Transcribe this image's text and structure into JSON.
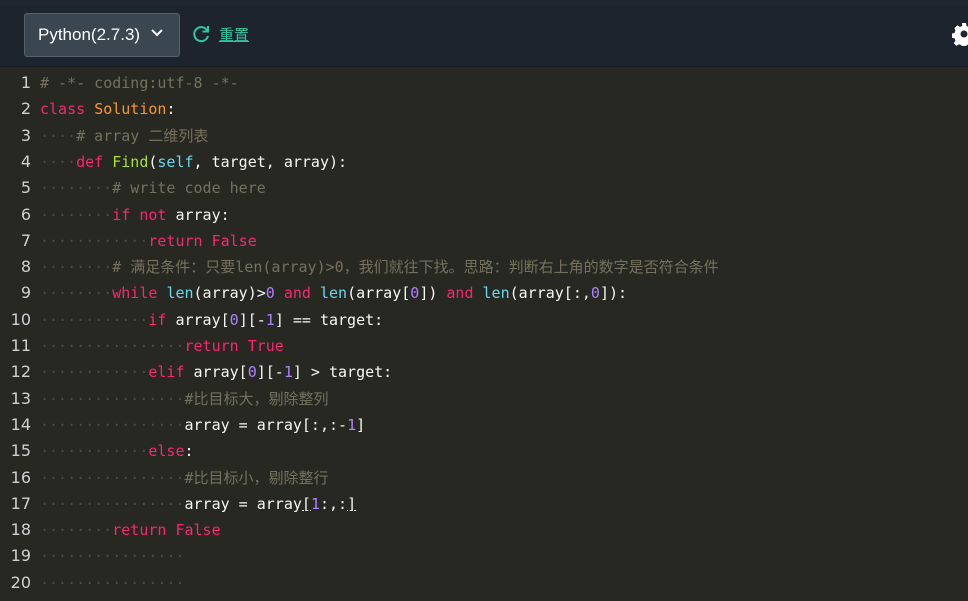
{
  "toolbar": {
    "language": "Python(2.7.3)",
    "reset_label": "重置"
  },
  "editor": {
    "lines": [
      {
        "n": "1",
        "tokens": [
          {
            "t": "# -*- coding:utf-8 -*-",
            "c": "cm"
          }
        ]
      },
      {
        "n": "2",
        "tokens": [
          {
            "t": "class",
            "c": "kw"
          },
          {
            "t": " ",
            "c": ""
          },
          {
            "t": "Solution",
            "c": "cls"
          },
          {
            "t": ":",
            "c": ""
          }
        ]
      },
      {
        "n": "3",
        "tokens": [
          {
            "t": "····",
            "c": "ws"
          },
          {
            "t": "# array 二维列表",
            "c": "cm"
          }
        ]
      },
      {
        "n": "4",
        "tokens": [
          {
            "t": "····",
            "c": "ws"
          },
          {
            "t": "def",
            "c": "kw"
          },
          {
            "t": " ",
            "c": ""
          },
          {
            "t": "Find",
            "c": "fn"
          },
          {
            "t": "(",
            "c": ""
          },
          {
            "t": "self",
            "c": "bi"
          },
          {
            "t": ", target, array):",
            "c": ""
          }
        ]
      },
      {
        "n": "5",
        "tokens": [
          {
            "t": "········",
            "c": "ws"
          },
          {
            "t": "# write code here",
            "c": "cm"
          }
        ]
      },
      {
        "n": "6",
        "tokens": [
          {
            "t": "········",
            "c": "ws"
          },
          {
            "t": "if",
            "c": "kw"
          },
          {
            "t": " ",
            "c": ""
          },
          {
            "t": "not",
            "c": "kw"
          },
          {
            "t": " array:",
            "c": ""
          }
        ]
      },
      {
        "n": "7",
        "tokens": [
          {
            "t": "············",
            "c": "ws"
          },
          {
            "t": "return",
            "c": "kw"
          },
          {
            "t": " ",
            "c": ""
          },
          {
            "t": "False",
            "c": "kw"
          }
        ]
      },
      {
        "n": "8",
        "tokens": [
          {
            "t": "········",
            "c": "ws"
          },
          {
            "t": "# 满足条件：只要len(array)>0，我们就往下找。思路：判断右上角的数字是否符合条件",
            "c": "cm"
          }
        ]
      },
      {
        "n": "9",
        "tokens": [
          {
            "t": "········",
            "c": "ws"
          },
          {
            "t": "while",
            "c": "kw"
          },
          {
            "t": " ",
            "c": ""
          },
          {
            "t": "len",
            "c": "bi"
          },
          {
            "t": "(array)>",
            "c": ""
          },
          {
            "t": "0",
            "c": "num"
          },
          {
            "t": " ",
            "c": ""
          },
          {
            "t": "and",
            "c": "kw"
          },
          {
            "t": " ",
            "c": ""
          },
          {
            "t": "len",
            "c": "bi"
          },
          {
            "t": "(array[",
            "c": ""
          },
          {
            "t": "0",
            "c": "num"
          },
          {
            "t": "]) ",
            "c": ""
          },
          {
            "t": "and",
            "c": "kw"
          },
          {
            "t": " ",
            "c": ""
          },
          {
            "t": "len",
            "c": "bi"
          },
          {
            "t": "(array[:,",
            "c": ""
          },
          {
            "t": "0",
            "c": "num"
          },
          {
            "t": "]):",
            "c": ""
          }
        ]
      },
      {
        "n": "10",
        "tokens": [
          {
            "t": "············",
            "c": "ws"
          },
          {
            "t": "if",
            "c": "kw"
          },
          {
            "t": " array[",
            "c": ""
          },
          {
            "t": "0",
            "c": "num"
          },
          {
            "t": "][-",
            "c": ""
          },
          {
            "t": "1",
            "c": "num"
          },
          {
            "t": "] == target:",
            "c": ""
          }
        ]
      },
      {
        "n": "11",
        "tokens": [
          {
            "t": "················",
            "c": "ws"
          },
          {
            "t": "return",
            "c": "kw"
          },
          {
            "t": " ",
            "c": ""
          },
          {
            "t": "True",
            "c": "kw"
          }
        ]
      },
      {
        "n": "12",
        "tokens": [
          {
            "t": "············",
            "c": "ws"
          },
          {
            "t": "elif",
            "c": "kw"
          },
          {
            "t": " array[",
            "c": ""
          },
          {
            "t": "0",
            "c": "num"
          },
          {
            "t": "][-",
            "c": ""
          },
          {
            "t": "1",
            "c": "num"
          },
          {
            "t": "] > target:",
            "c": ""
          }
        ]
      },
      {
        "n": "13",
        "tokens": [
          {
            "t": "················",
            "c": "ws"
          },
          {
            "t": "#比目标大，剔除整列",
            "c": "cm"
          }
        ]
      },
      {
        "n": "14",
        "tokens": [
          {
            "t": "················",
            "c": "ws"
          },
          {
            "t": "array = array[:,:-",
            "c": ""
          },
          {
            "t": "1",
            "c": "num"
          },
          {
            "t": "]",
            "c": ""
          }
        ]
      },
      {
        "n": "15",
        "tokens": [
          {
            "t": "············",
            "c": "ws"
          },
          {
            "t": "else",
            "c": "kw"
          },
          {
            "t": ":",
            "c": ""
          }
        ]
      },
      {
        "n": "16",
        "tokens": [
          {
            "t": "················",
            "c": "ws"
          },
          {
            "t": "#比目标小，剔除整行",
            "c": "cm"
          }
        ]
      },
      {
        "n": "17",
        "tokens": [
          {
            "t": "················",
            "c": "ws"
          },
          {
            "t": "array = array",
            "c": ""
          },
          {
            "t": "[",
            "c": "ul"
          },
          {
            "t": "1",
            "c": "num"
          },
          {
            "t": ":,:",
            "c": ""
          },
          {
            "t": "]",
            "c": "ul"
          }
        ]
      },
      {
        "n": "18",
        "tokens": [
          {
            "t": "········",
            "c": "ws"
          },
          {
            "t": "return",
            "c": "kw"
          },
          {
            "t": " ",
            "c": ""
          },
          {
            "t": "False",
            "c": "kw"
          }
        ]
      },
      {
        "n": "19",
        "tokens": [
          {
            "t": "················",
            "c": "ws"
          }
        ]
      },
      {
        "n": "20",
        "tokens": [
          {
            "t": "················",
            "c": "ws"
          }
        ]
      }
    ]
  }
}
